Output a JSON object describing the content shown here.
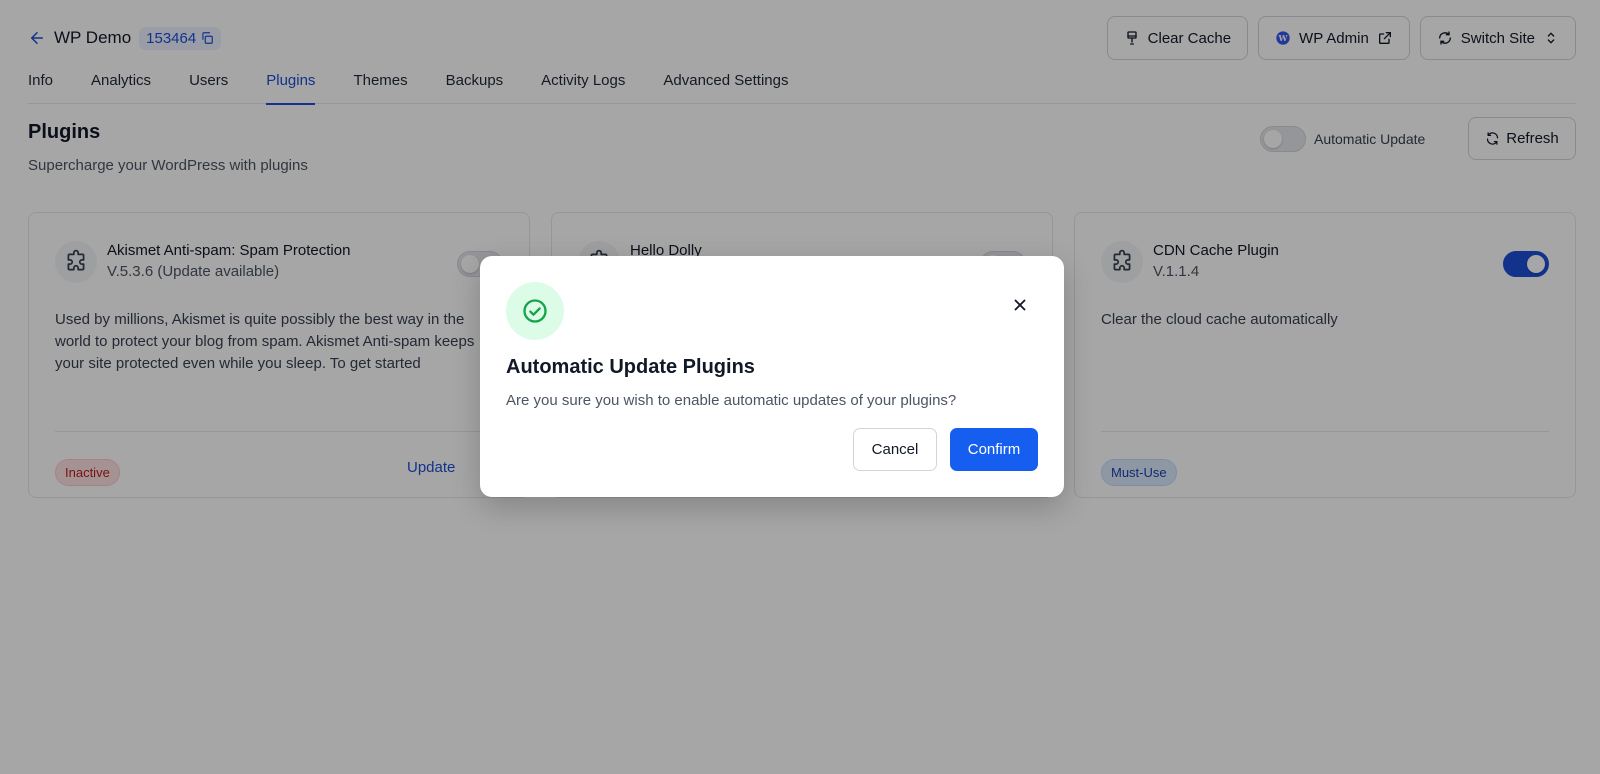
{
  "header": {
    "site_name": "WP Demo",
    "site_id": "153464",
    "actions": {
      "clear_cache": "Clear Cache",
      "wp_admin": "WP Admin",
      "switch_site": "Switch Site"
    }
  },
  "tabs": [
    "Info",
    "Analytics",
    "Users",
    "Plugins",
    "Themes",
    "Backups",
    "Activity Logs",
    "Advanced Settings"
  ],
  "active_tab": "Plugins",
  "section": {
    "title": "Plugins",
    "subtitle": "Supercharge your WordPress with plugins",
    "auto_update_label": "Automatic Update",
    "auto_update_enabled": false,
    "refresh_label": "Refresh"
  },
  "plugins": [
    {
      "name": "Akismet Anti-spam: Spam Protection",
      "version": "V.5.3.6 (Update available)",
      "description": "Used by millions, Akismet is quite possibly the best way in the world to protect your blog from spam. Akismet Anti-spam keeps your site protected even while you sleep. To get started",
      "enabled": false,
      "status": "Inactive",
      "action": "Update"
    },
    {
      "name": "Hello Dolly",
      "version": "",
      "description": "",
      "enabled": false,
      "status": "",
      "action": ""
    },
    {
      "name": "CDN Cache Plugin",
      "version": "V.1.1.4",
      "description": "Clear the cloud cache automatically",
      "enabled": true,
      "status": "Must-Use",
      "action": ""
    }
  ],
  "modal": {
    "title": "Automatic Update Plugins",
    "message": "Are you sure you wish to enable automatic updates of your plugins?",
    "cancel_label": "Cancel",
    "confirm_label": "Confirm",
    "icon": "check-circle-icon"
  },
  "colors": {
    "accent": "#1d4ed8",
    "confirm": "#155eef",
    "success": "#16a34a"
  }
}
